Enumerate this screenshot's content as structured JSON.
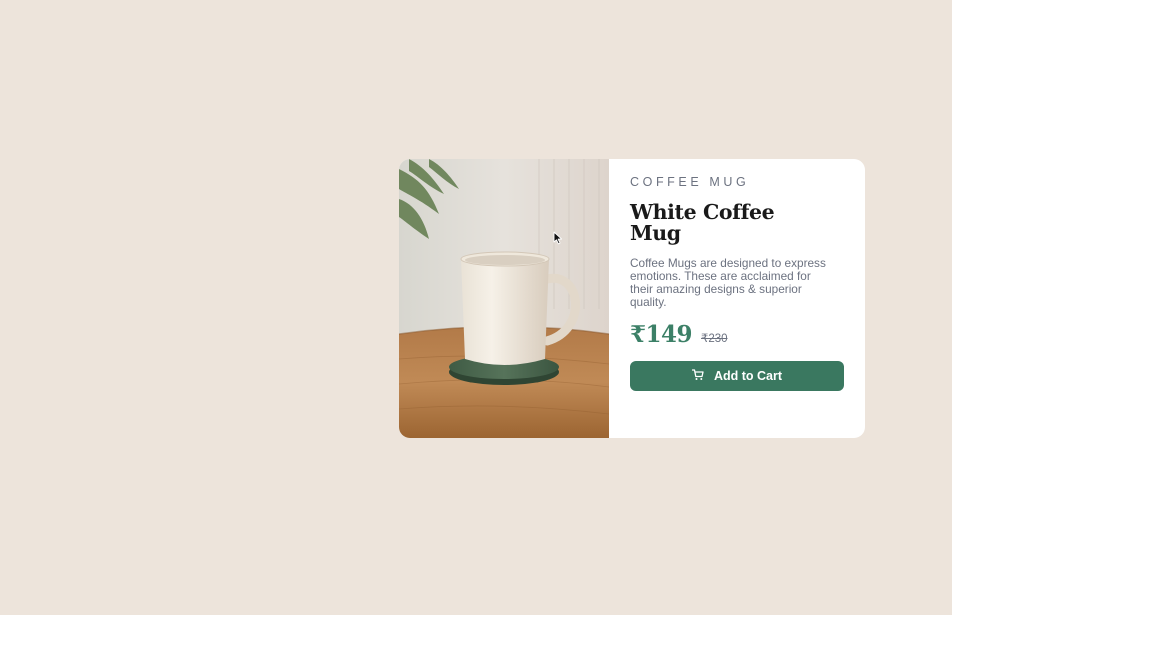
{
  "product": {
    "category": "Coffee Mug",
    "title": "White Coffee Mug",
    "description": "Coffee Mugs are designed to express emotions. These are acclaimed for their amazing designs & superior quality.",
    "price": "₹149",
    "old_price": "₹230",
    "cta_label": "Add to Cart",
    "cta_icon": "shopping-cart-icon",
    "image_subject": "white-coffee-mug-photo"
  },
  "colors": {
    "page_background": "#ede4db",
    "card_background": "#ffffff",
    "accent": "#3a7860",
    "price": "#3c8067",
    "muted_text": "#6c7280",
    "title_text": "#1a1a1a"
  }
}
